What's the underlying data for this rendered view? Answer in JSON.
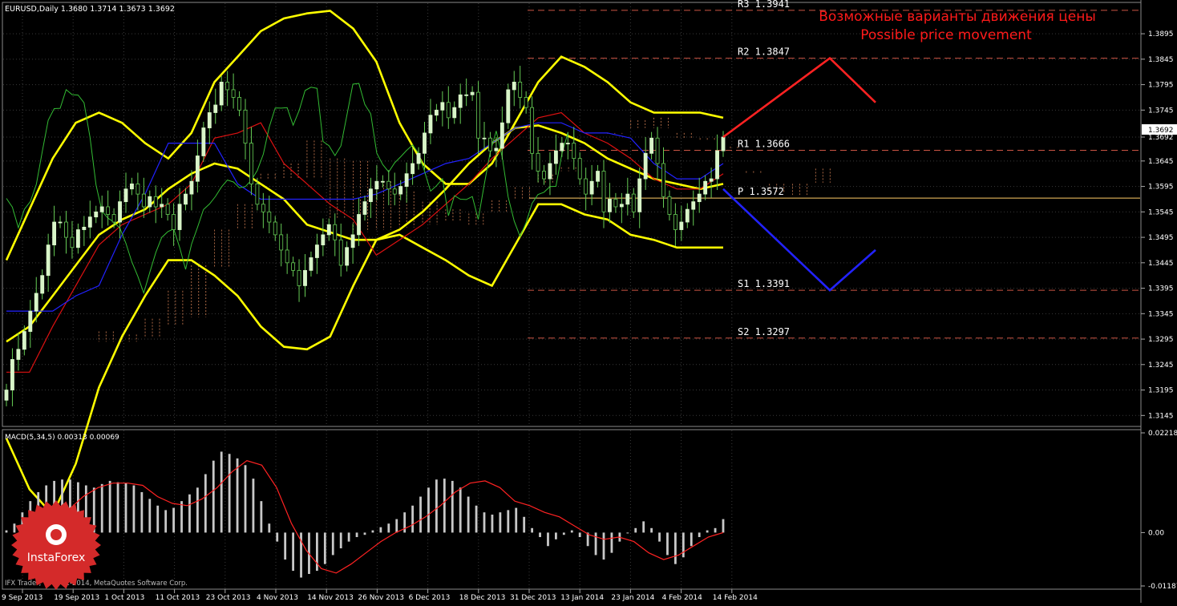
{
  "header": {
    "symbol_info": "EURUSD,Daily  1.3680 1.3714 1.3673 1.3692",
    "forecast_ru": "Возможные варианты движения цены",
    "forecast_en": "Possible price movement"
  },
  "macd_panel": {
    "label": "MACD(5,34,5) 0.00313 0.00069",
    "copyright": "IFX Trader, © 2001-2014, MetaQuotes Software Corp."
  },
  "logo": {
    "text": "InstaForex"
  },
  "colors": {
    "background": "#000000",
    "grid": "#3a3a3a",
    "axis_text": "#ffffff",
    "bull_candle": "#d8f5c8",
    "candle_wick": "#66cc55",
    "bollinger": "#ffff00",
    "tenkan": "#dd1111",
    "kijun": "#2222ff",
    "chikou": "#33bb33",
    "cloud_hatch": "#c87a50",
    "forecast_up": "#ff2222",
    "forecast_down": "#2222ff",
    "pivot_line": "#ffcc66",
    "level_dash": "#cc5544",
    "macd_hist": "#c8c8c8",
    "macd_signal": "#ff2222",
    "current_price_bg": "#ffffff",
    "logo_red": "#d42a2a"
  },
  "chart_data": [
    {
      "type": "candlestick",
      "title": "EURUSD,Daily",
      "ylim": [
        1.3125,
        1.3955
      ],
      "y_ticks": [
        "1.3895",
        "1.3845",
        "1.3795",
        "1.3745",
        "1.3692",
        "1.3645",
        "1.3595",
        "1.3545",
        "1.3495",
        "1.3445",
        "1.3395",
        "1.3345",
        "1.3295",
        "1.3245",
        "1.3195",
        "1.3145"
      ],
      "x_ticks": [
        "9 Sep 2013",
        "19 Sep 2013",
        "1 Oct 2013",
        "11 Oct 2013",
        "23 Oct 2013",
        "4 Nov 2013",
        "14 Nov 2013",
        "26 Nov 2013",
        "6 Dec 2013",
        "18 Dec 2013",
        "31 Dec 2013",
        "13 Jan 2014",
        "23 Jan 2014",
        "4 Feb 2014",
        "14 Feb 2014"
      ],
      "current_price": "1.3692",
      "levels": [
        {
          "name": "R3",
          "value": 1.3941,
          "label": "R3  1.3941"
        },
        {
          "name": "R2",
          "value": 1.3847,
          "label": "R2  1.3847"
        },
        {
          "name": "R1",
          "value": 1.3666,
          "label": "R1  1.3666"
        },
        {
          "name": "P",
          "value": 1.3572,
          "label": "P  1.3572"
        },
        {
          "name": "S1",
          "value": 1.3391,
          "label": "S1  1.3391"
        },
        {
          "name": "S2",
          "value": 1.3297,
          "label": "S2  1.3297"
        }
      ],
      "close": [
        1.3195,
        1.3255,
        1.3275,
        1.331,
        1.335,
        1.3385,
        1.342,
        1.348,
        1.3525,
        1.3525,
        1.3495,
        1.3475,
        1.351,
        1.3515,
        1.3535,
        1.3545,
        1.3555,
        1.354,
        1.3525,
        1.3565,
        1.359,
        1.36,
        1.358,
        1.3555,
        1.3575,
        1.3555,
        1.356,
        1.354,
        1.351,
        1.356,
        1.358,
        1.3605,
        1.3655,
        1.371,
        1.374,
        1.3755,
        1.38,
        1.3785,
        1.377,
        1.3745,
        1.368,
        1.36,
        1.356,
        1.3545,
        1.3525,
        1.35,
        1.347,
        1.3445,
        1.343,
        1.34,
        1.343,
        1.3455,
        1.348,
        1.35,
        1.352,
        1.349,
        1.344,
        1.3475,
        1.35,
        1.354,
        1.3565,
        1.359,
        1.3605,
        1.3605,
        1.359,
        1.358,
        1.3595,
        1.362,
        1.364,
        1.366,
        1.37,
        1.3735,
        1.3745,
        1.376,
        1.373,
        1.375,
        1.3775,
        1.3775,
        1.378,
        1.369,
        1.369,
        1.3665,
        1.367,
        1.372,
        1.3785,
        1.38,
        1.377,
        1.375,
        1.366,
        1.3625,
        1.361,
        1.364,
        1.3665,
        1.368,
        1.368,
        1.365,
        1.361,
        1.358,
        1.3605,
        1.3625,
        1.3545,
        1.357,
        1.3555,
        1.356,
        1.358,
        1.3545,
        1.361,
        1.366,
        1.369,
        1.364,
        1.3575,
        1.354,
        1.351,
        1.3525,
        1.355,
        1.3565,
        1.358,
        1.3605,
        1.361,
        1.3665,
        1.3692
      ],
      "series": [
        {
          "name": "Bollinger upper",
          "values": [
            1.345,
            1.355,
            1.365,
            1.372,
            1.374,
            1.372,
            1.368,
            1.365,
            1.37,
            1.38,
            1.385,
            1.39,
            1.3925,
            1.3935,
            1.394,
            1.3905,
            1.384,
            1.372,
            1.364,
            1.36,
            1.36,
            1.364,
            1.372,
            1.38,
            1.385,
            1.383,
            1.38,
            1.376,
            1.374,
            1.374,
            1.374,
            1.373
          ]
        },
        {
          "name": "Bollinger middle",
          "values": [
            1.329,
            1.332,
            1.338,
            1.344,
            1.35,
            1.353,
            1.355,
            1.359,
            1.362,
            1.364,
            1.363,
            1.36,
            1.357,
            1.352,
            1.3505,
            1.349,
            1.349,
            1.351,
            1.3545,
            1.359,
            1.364,
            1.368,
            1.371,
            1.3715,
            1.37,
            1.368,
            1.365,
            1.363,
            1.361,
            1.36,
            1.359,
            1.36
          ]
        },
        {
          "name": "Bollinger lower",
          "values": [
            1.31,
            1.3,
            1.295,
            1.305,
            1.32,
            1.33,
            1.338,
            1.345,
            1.345,
            1.342,
            1.338,
            1.332,
            1.328,
            1.3275,
            1.33,
            1.34,
            1.349,
            1.35,
            1.3475,
            1.345,
            1.342,
            1.34,
            1.348,
            1.356,
            1.356,
            1.354,
            1.353,
            1.35,
            1.349,
            1.3475,
            1.3475,
            1.3475
          ]
        },
        {
          "name": "Tenkan-sen",
          "values": [
            1.323,
            1.323,
            1.332,
            1.34,
            1.348,
            1.352,
            1.354,
            1.356,
            1.36,
            1.369,
            1.37,
            1.372,
            1.364,
            1.36,
            1.356,
            1.353,
            1.346,
            1.349,
            1.352,
            1.356,
            1.36,
            1.365,
            1.369,
            1.373,
            1.374,
            1.37,
            1.368,
            1.365,
            1.361,
            1.359,
            1.359,
            1.362
          ]
        },
        {
          "name": "Kijun-sen",
          "values": [
            1.335,
            1.335,
            1.335,
            1.338,
            1.34,
            1.35,
            1.358,
            1.368,
            1.368,
            1.368,
            1.36,
            1.357,
            1.357,
            1.357,
            1.357,
            1.357,
            1.358,
            1.36,
            1.362,
            1.364,
            1.365,
            1.368,
            1.371,
            1.372,
            1.372,
            1.37,
            1.37,
            1.369,
            1.364,
            1.361,
            1.361,
            1.364
          ]
        }
      ],
      "forecast": [
        {
          "name": "up",
          "points": [
            1.3692,
            1.3847,
            1.376
          ]
        },
        {
          "name": "down",
          "points": [
            1.359,
            1.3391,
            1.347
          ]
        }
      ]
    },
    {
      "type": "bar",
      "title": "MACD(5,34,5)",
      "ylim": [
        -0.01187,
        0.02218
      ],
      "y_ticks": [
        "0.02218",
        "0.00",
        "-0.01187"
      ],
      "values": [
        0.0005,
        0.002,
        0.0045,
        0.007,
        0.009,
        0.0105,
        0.0115,
        0.0118,
        0.0118,
        0.0112,
        0.0105,
        0.01,
        0.0108,
        0.0115,
        0.0112,
        0.011,
        0.0105,
        0.009,
        0.0075,
        0.006,
        0.005,
        0.0055,
        0.007,
        0.0085,
        0.01,
        0.013,
        0.016,
        0.018,
        0.0175,
        0.0165,
        0.015,
        0.012,
        0.007,
        0.002,
        -0.002,
        -0.006,
        -0.0085,
        -0.01,
        -0.0092,
        -0.0085,
        -0.007,
        -0.005,
        -0.0035,
        -0.002,
        -0.001,
        -0.0005,
        0.0005,
        0.0012,
        0.002,
        0.003,
        0.0045,
        0.006,
        0.008,
        0.01,
        0.0118,
        0.012,
        0.0115,
        0.01,
        0.008,
        0.006,
        0.0045,
        0.004,
        0.0045,
        0.005,
        0.0055,
        0.0035,
        0.001,
        -0.001,
        -0.003,
        -0.0015,
        -0.0005,
        0.0005,
        -0.001,
        -0.003,
        -0.005,
        -0.006,
        -0.0045,
        -0.002,
        0.0,
        0.001,
        0.0025,
        0.001,
        -0.002,
        -0.005,
        -0.007,
        -0.0055,
        -0.003,
        -0.001,
        0.0005,
        0.001,
        0.003
      ],
      "signal": [
        0.0,
        0.002,
        0.005,
        0.008,
        0.01,
        0.011,
        0.011,
        0.0105,
        0.008,
        0.0065,
        0.006,
        0.0075,
        0.01,
        0.0135,
        0.016,
        0.015,
        0.01,
        0.002,
        -0.004,
        -0.008,
        -0.009,
        -0.007,
        -0.0045,
        -0.002,
        0.0,
        0.0015,
        0.0035,
        0.006,
        0.009,
        0.011,
        0.0115,
        0.01,
        0.007,
        0.006,
        0.0045,
        0.0035,
        0.0015,
        -0.0005,
        -0.0015,
        -0.001,
        -0.002,
        -0.0045,
        -0.006,
        -0.005,
        -0.003,
        -0.001,
        0.0
      ]
    }
  ]
}
